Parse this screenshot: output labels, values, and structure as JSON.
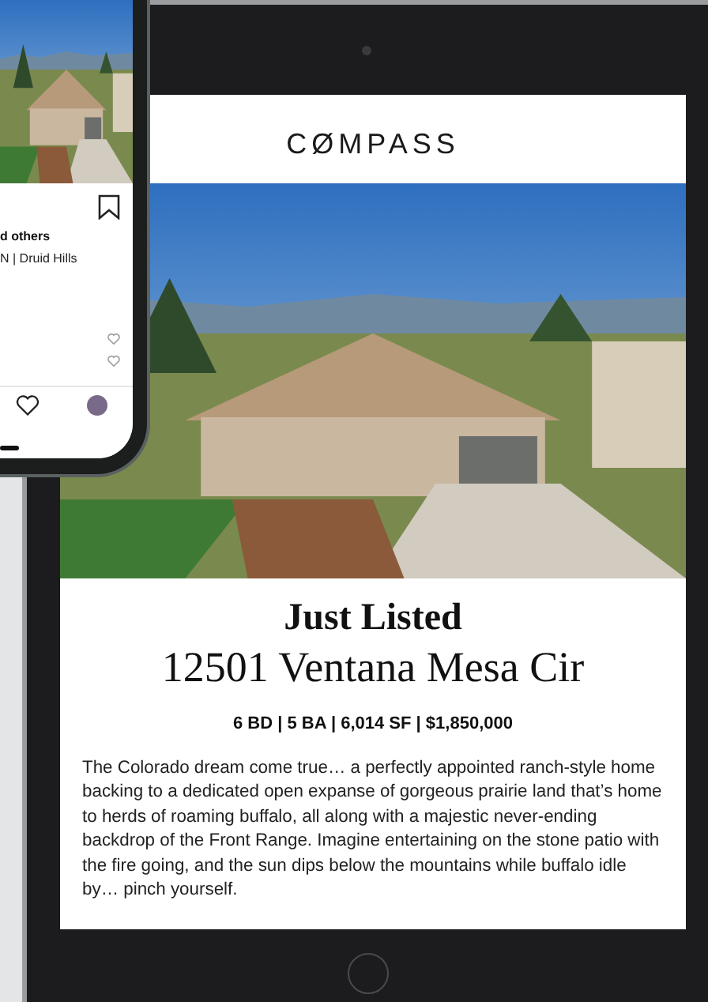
{
  "tablet": {
    "logo": "CØMPASS",
    "heading": "Just Listed",
    "address": "12501 Ventana Mesa Cir",
    "facts": "6 BD | 5 BA | 6,014 SF | $1,850,000",
    "description": "The Colorado dream come true… a perfectly appointed ranch-style home backing to a dedicated open expanse of gorgeous prairie land that’s home to herds of roaming buffalo, all along with a majestic never-ending backdrop of the Front Range. Imagine entertaining on the stone patio with the fire going, and the sun dips below the mountains while buffalo idle by… pinch yourself."
  },
  "phone": {
    "caption_lines": [
      "d others",
      "N | Druid Hills"
    ]
  }
}
